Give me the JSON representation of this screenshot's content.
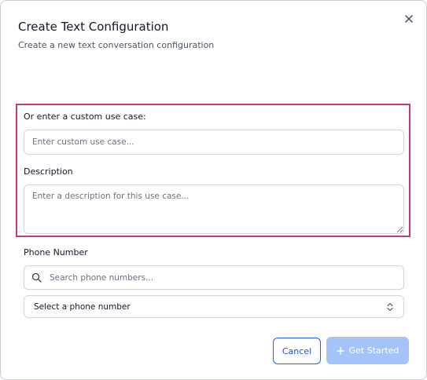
{
  "dialog": {
    "title": "Create Text Configuration",
    "subtitle": "Create a new text conversation configuration"
  },
  "custom_use_case": {
    "label": "Or enter a custom use case:",
    "placeholder": "Enter custom use case..."
  },
  "description": {
    "label": "Description",
    "placeholder": "Enter a description for this use case..."
  },
  "phone_number": {
    "label": "Phone Number",
    "search_placeholder": "Search phone numbers...",
    "select_value": "Select a phone number"
  },
  "actions": {
    "cancel_label": "Cancel",
    "get_started_label": "Get Started"
  },
  "colors": {
    "highlight": "#c8367d",
    "primary": "#2563eb",
    "primary_disabled": "#a4c3f9"
  },
  "icons": {
    "close": "close-icon",
    "search": "search-icon",
    "select": "chevron-up-down-icon",
    "plus": "plus-icon"
  }
}
